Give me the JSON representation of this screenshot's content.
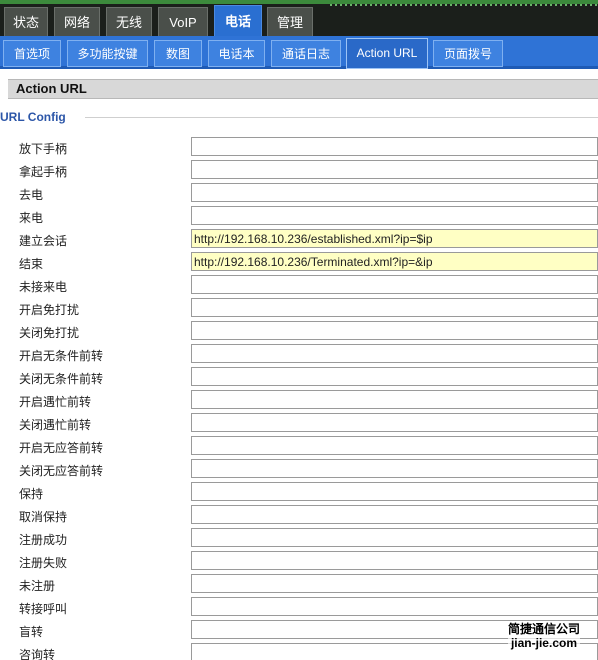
{
  "main_tabs": [
    "状态",
    "网络",
    "无线",
    "VoIP",
    "电话",
    "管理"
  ],
  "main_active": "电话",
  "sub_tabs": [
    "首选项",
    "多功能按键",
    "数图",
    "电话本",
    "通话日志",
    "Action URL",
    "页面拨号"
  ],
  "sub_active": "Action URL",
  "section_title": "Action URL",
  "legend": "URL Config",
  "rows": [
    {
      "label": "放下手柄",
      "value": ""
    },
    {
      "label": "拿起手柄",
      "value": ""
    },
    {
      "label": "去电",
      "value": ""
    },
    {
      "label": "来电",
      "value": ""
    },
    {
      "label": "建立会话",
      "value": "http://192.168.10.236/established.xml?ip=$ip"
    },
    {
      "label": "结束",
      "value": "http://192.168.10.236/Terminated.xml?ip=&ip"
    },
    {
      "label": "未接来电",
      "value": ""
    },
    {
      "label": "开启免打扰",
      "value": ""
    },
    {
      "label": "关闭免打扰",
      "value": ""
    },
    {
      "label": "开启无条件前转",
      "value": ""
    },
    {
      "label": "关闭无条件前转",
      "value": ""
    },
    {
      "label": "开启遇忙前转",
      "value": ""
    },
    {
      "label": "关闭遇忙前转",
      "value": ""
    },
    {
      "label": "开启无应答前转",
      "value": ""
    },
    {
      "label": "关闭无应答前转",
      "value": ""
    },
    {
      "label": "保持",
      "value": ""
    },
    {
      "label": "取消保持",
      "value": ""
    },
    {
      "label": "注册成功",
      "value": ""
    },
    {
      "label": "注册失败",
      "value": ""
    },
    {
      "label": "未注册",
      "value": ""
    },
    {
      "label": "转接呼叫",
      "value": ""
    },
    {
      "label": "盲转",
      "value": ""
    },
    {
      "label": "咨询转",
      "value": ""
    }
  ],
  "watermark": {
    "line1": "简捷通信公司",
    "line2": "jian-jie.com"
  }
}
